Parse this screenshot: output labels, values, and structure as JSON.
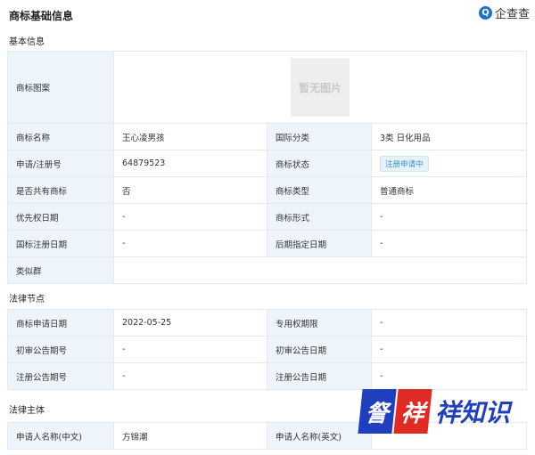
{
  "header": {
    "title": "商标基础信息",
    "logo_text": "企查查",
    "logo_mark": "Q"
  },
  "basic": {
    "section_title": "基本信息",
    "image_label": "商标图案",
    "image_placeholder": "暂无图片",
    "rows": [
      {
        "l1": "商标名称",
        "v1": "王心凌男孩",
        "l2": "国际分类",
        "v2": "3类 日化用品"
      },
      {
        "l1": "申请/注册号",
        "v1": "64879523",
        "l2": "商标状态",
        "v2": "注册申请中"
      },
      {
        "l1": "是否共有商标",
        "v1": "否",
        "l2": "商标类型",
        "v2": "普通商标"
      },
      {
        "l1": "优先权日期",
        "v1": "-",
        "l2": "商标形式",
        "v2": "-"
      },
      {
        "l1": "国标注册日期",
        "v1": "-",
        "l2": "后期指定日期",
        "v2": "-"
      }
    ],
    "similar_label": "类似群"
  },
  "legal": {
    "section_title": "法律节点",
    "rows": [
      {
        "l1": "商标申请日期",
        "v1": "2022-05-25",
        "l2": "专用权期限",
        "v2": "-"
      },
      {
        "l1": "初审公告期号",
        "v1": "-",
        "l2": "初审公告日期",
        "v2": "-"
      },
      {
        "l1": "注册公告期号",
        "v1": "-",
        "l2": "注册公告日期",
        "v2": "-"
      }
    ]
  },
  "subject": {
    "section_title": "法律主体",
    "rows": [
      {
        "l1": "申请人名称(中文)",
        "v1": "方锦潮",
        "l2": "申请人名称(英文)",
        "v2": ""
      }
    ]
  },
  "watermark": {
    "char1": "詧",
    "char2": "祥",
    "text": "祥知识"
  }
}
